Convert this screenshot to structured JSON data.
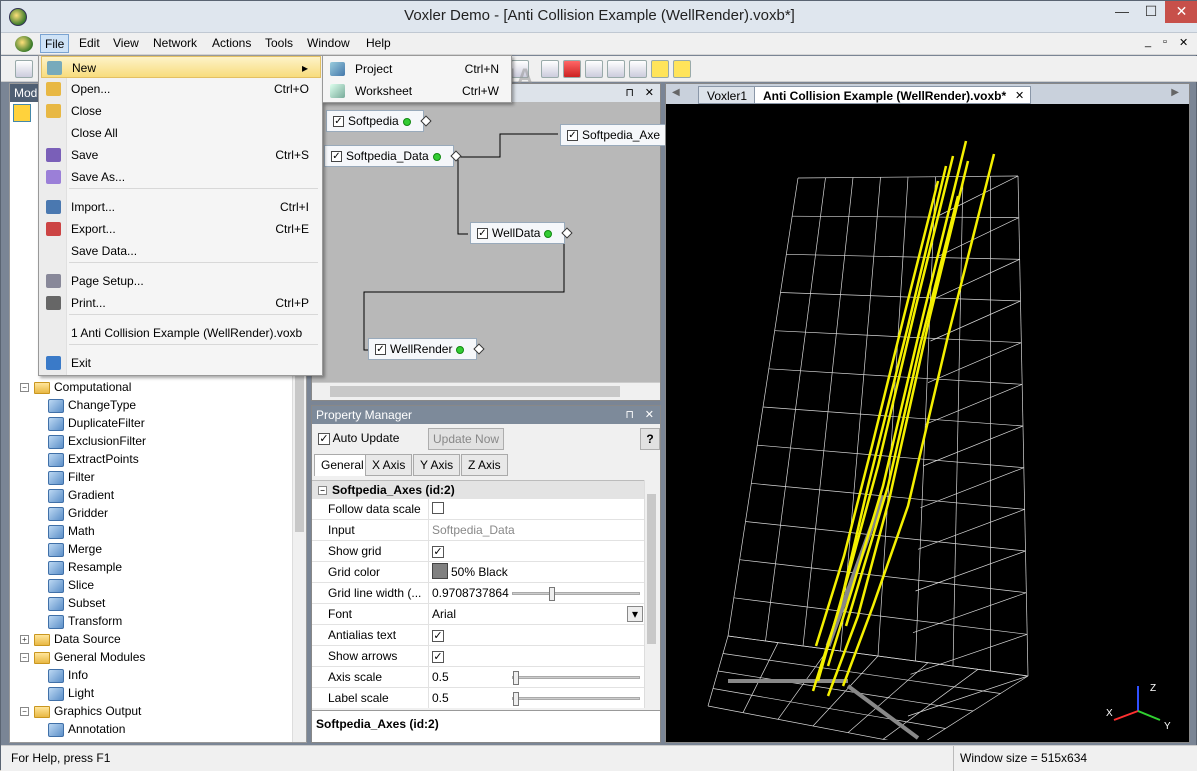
{
  "window": {
    "title": "Voxler Demo - [Anti Collision Example (WellRender).voxb*]",
    "controls": {
      "minimize": "—",
      "maximize": "☐",
      "close": "✕"
    }
  },
  "menubar": {
    "items": [
      "File",
      "Edit",
      "View",
      "Network",
      "Actions",
      "Tools",
      "Window",
      "Help"
    ],
    "active": "File",
    "mdi_controls": [
      "_",
      "▫",
      "✕"
    ]
  },
  "file_menu": {
    "items": [
      {
        "label": "New",
        "shortcut": "",
        "submenu_arrow": "▸",
        "icon": "new-icon"
      },
      {
        "label": "Open...",
        "shortcut": "Ctrl+O",
        "icon": "open-folder-icon"
      },
      {
        "label": "Close",
        "shortcut": "",
        "icon": "close-folder-icon"
      },
      {
        "label": "Close All",
        "shortcut": ""
      },
      {
        "label": "Save",
        "shortcut": "Ctrl+S",
        "icon": "save-icon"
      },
      {
        "label": "Save As...",
        "shortcut": "",
        "icon": "save-as-icon"
      },
      {
        "label": "Import...",
        "shortcut": "Ctrl+I",
        "icon": "import-icon"
      },
      {
        "label": "Export...",
        "shortcut": "Ctrl+E",
        "icon": "export-icon"
      },
      {
        "label": "Save Data...",
        "shortcut": ""
      },
      {
        "label": "Page Setup...",
        "shortcut": "",
        "icon": "page-setup-icon"
      },
      {
        "label": "Print...",
        "shortcut": "Ctrl+P",
        "icon": "print-icon"
      },
      {
        "label": "1 Anti Collision Example (WellRender).voxb",
        "shortcut": ""
      },
      {
        "label": "Exit",
        "shortcut": "",
        "icon": "exit-icon"
      }
    ]
  },
  "new_submenu": {
    "items": [
      {
        "label": "Project",
        "shortcut": "Ctrl+N"
      },
      {
        "label": "Worksheet",
        "shortcut": "Ctrl+W"
      }
    ]
  },
  "module_panel": {
    "title": "Mod",
    "tree": [
      {
        "label": "Computational",
        "type": "folder",
        "expander": "−"
      },
      {
        "label": "ChangeType",
        "type": "module"
      },
      {
        "label": "DuplicateFilter",
        "type": "module"
      },
      {
        "label": "ExclusionFilter",
        "type": "module"
      },
      {
        "label": "ExtractPoints",
        "type": "module"
      },
      {
        "label": "Filter",
        "type": "module"
      },
      {
        "label": "Gradient",
        "type": "module"
      },
      {
        "label": "Gridder",
        "type": "module"
      },
      {
        "label": "Math",
        "type": "module"
      },
      {
        "label": "Merge",
        "type": "module"
      },
      {
        "label": "Resample",
        "type": "module"
      },
      {
        "label": "Slice",
        "type": "module"
      },
      {
        "label": "Subset",
        "type": "module"
      },
      {
        "label": "Transform",
        "type": "module"
      },
      {
        "label": "Data Source",
        "type": "folder",
        "expander": "+"
      },
      {
        "label": "General Modules",
        "type": "folder",
        "expander": "−"
      },
      {
        "label": "Info",
        "type": "module"
      },
      {
        "label": "Light",
        "type": "module"
      },
      {
        "label": "Graphics Output",
        "type": "folder",
        "expander": "−"
      },
      {
        "label": "Annotation",
        "type": "module"
      }
    ]
  },
  "network": {
    "nodes": [
      {
        "label": "Softpedia",
        "checked": "✓"
      },
      {
        "label": "Softpedia_Data",
        "checked": "✓"
      },
      {
        "label": "Softpedia_Axe",
        "checked": "✓"
      },
      {
        "label": "WellData",
        "checked": "✓"
      },
      {
        "label": "WellRender",
        "checked": "✓"
      }
    ]
  },
  "property_manager": {
    "title": "Property Manager",
    "auto_update": {
      "label": "Auto Update",
      "checked": "✓"
    },
    "update_now": "Update Now",
    "help": "?",
    "tabs": [
      "General",
      "X Axis",
      "Y Axis",
      "Z Axis"
    ],
    "active_tab": "General",
    "section": "Softpedia_Axes (id:2)",
    "section_expander": "−",
    "rows": [
      {
        "key": "Follow data scale",
        "value": "",
        "checkbox": ""
      },
      {
        "key": "Input",
        "value": "Softpedia_Data"
      },
      {
        "key": "Show grid",
        "value": "",
        "checkbox": "✓"
      },
      {
        "key": "Grid color",
        "value": "50% Black",
        "swatch": "#808080"
      },
      {
        "key": "Grid line width (...",
        "value": "0.9708737864",
        "slider": 0.3
      },
      {
        "key": "Font",
        "value": "Arial",
        "dropdown": "▾"
      },
      {
        "key": "Antialias text",
        "value": "",
        "checkbox": "✓"
      },
      {
        "key": "Show arrows",
        "value": "",
        "checkbox": "✓"
      },
      {
        "key": "Axis scale",
        "value": "0.5",
        "slider": 0.0
      },
      {
        "key": "Label scale",
        "value": "0.5",
        "slider": 0.0
      }
    ],
    "footer": "Softpedia_Axes (id:2)"
  },
  "viewer": {
    "tabs": [
      "Voxler1",
      "Anti Collision Example (WellRender).voxb*"
    ],
    "active_tab": "Anti Collision Example (WellRender).voxb*",
    "tab_close": "✕",
    "axis_labels": {
      "x": "X",
      "y": "Y",
      "z": "Z"
    },
    "colors": {
      "wells": "#f4f000",
      "grid": "#d8d8d8",
      "background": "#000000"
    }
  },
  "statusbar": {
    "help": "For Help, press F1",
    "window_size": "Window size = 515x634"
  },
  "panel_controls": {
    "pin": "⊓",
    "close": "✕"
  },
  "watermark": "SOFTPEDIA"
}
